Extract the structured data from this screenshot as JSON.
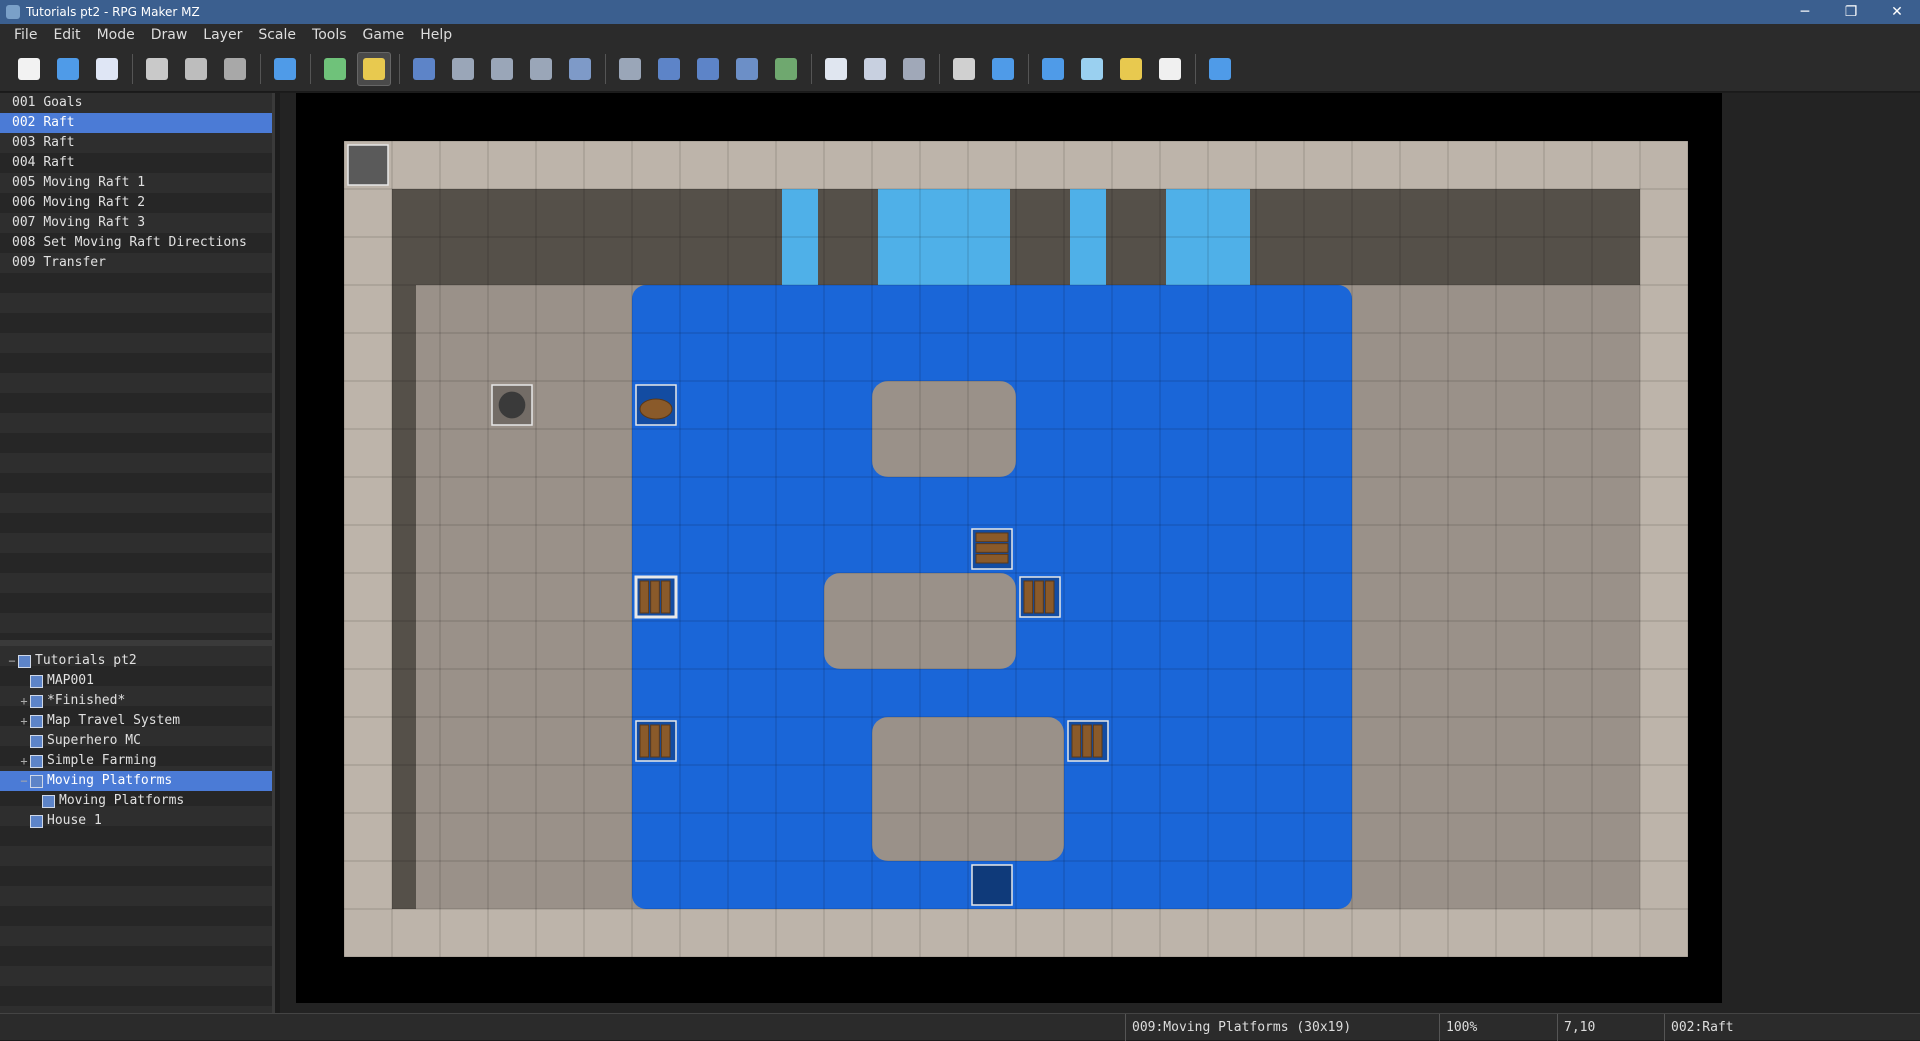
{
  "window": {
    "title": "Tutorials pt2 - RPG Maker MZ",
    "minimize": "─",
    "maximize": "❐",
    "close": "✕"
  },
  "menu": [
    "File",
    "Edit",
    "Mode",
    "Draw",
    "Layer",
    "Scale",
    "Tools",
    "Game",
    "Help"
  ],
  "toolbar": {
    "groups": [
      [
        {
          "name": "new-project-icon",
          "color": "#f2f2f2"
        },
        {
          "name": "open-project-icon",
          "color": "#4f9be8"
        },
        {
          "name": "save-project-icon",
          "color": "#dfe6f5"
        }
      ],
      [
        {
          "name": "cut-icon",
          "color": "#c9c9c9"
        },
        {
          "name": "copy-icon",
          "color": "#bdbdbd"
        },
        {
          "name": "paste-icon",
          "color": "#a8a8a8"
        }
      ],
      [
        {
          "name": "undo-icon",
          "color": "#4f9be8"
        }
      ],
      [
        {
          "name": "map-mode-icon",
          "color": "#6fc27a"
        },
        {
          "name": "event-mode-icon",
          "color": "#e8c94f",
          "active": true
        }
      ],
      [
        {
          "name": "layer-1-icon",
          "color": "#5d84c8"
        },
        {
          "name": "layer-2-icon",
          "color": "#9aa6b8"
        },
        {
          "name": "layer-3-icon",
          "color": "#9aa6b8"
        },
        {
          "name": "layer-4-icon",
          "color": "#9aa6b8"
        },
        {
          "name": "layer-all-icon",
          "color": "#7e9ac8"
        }
      ],
      [
        {
          "name": "pencil-icon",
          "color": "#9aa6b8"
        },
        {
          "name": "rectangle-icon",
          "color": "#5d84c8"
        },
        {
          "name": "ellipse-icon",
          "color": "#5d84c8"
        },
        {
          "name": "flood-fill-icon",
          "color": "#6c8fc7"
        },
        {
          "name": "shadow-pen-icon",
          "color": "#6fa86f"
        }
      ],
      [
        {
          "name": "zoom-in-icon",
          "color": "#e0e6f0"
        },
        {
          "name": "zoom-out-icon",
          "color": "#c8d0e0"
        },
        {
          "name": "actual-size-icon",
          "color": "#a0a8b8"
        }
      ],
      [
        {
          "name": "database-icon",
          "color": "#d0d0d0"
        },
        {
          "name": "plugin-manager-icon",
          "color": "#4f9be8"
        }
      ],
      [
        {
          "name": "sound-test-icon",
          "color": "#4f9be8"
        },
        {
          "name": "event-searcher-icon",
          "color": "#9ad0f0"
        },
        {
          "name": "resource-manager-icon",
          "color": "#e8c94f"
        },
        {
          "name": "character-generator-icon",
          "color": "#f0f0f0"
        }
      ],
      [
        {
          "name": "playtest-icon",
          "color": "#4f9be8"
        }
      ]
    ]
  },
  "events": [
    {
      "id": "001",
      "name": "Goals"
    },
    {
      "id": "002",
      "name": "Raft",
      "selected": true
    },
    {
      "id": "003",
      "name": "Raft"
    },
    {
      "id": "004",
      "name": "Raft"
    },
    {
      "id": "005",
      "name": "Moving Raft 1"
    },
    {
      "id": "006",
      "name": "Moving Raft 2"
    },
    {
      "id": "007",
      "name": "Moving Raft 3"
    },
    {
      "id": "008",
      "name": "Set Moving Raft Directions"
    },
    {
      "id": "009",
      "name": "Transfer"
    }
  ],
  "map_tree": [
    {
      "label": "Tutorials pt2",
      "level": 0,
      "toggle": "−",
      "root": true
    },
    {
      "label": "MAP001",
      "level": 1,
      "toggle": ""
    },
    {
      "label": "*Finished*",
      "level": 1,
      "toggle": "+"
    },
    {
      "label": "Map Travel System",
      "level": 1,
      "toggle": "+"
    },
    {
      "label": "Superhero MC",
      "level": 1,
      "toggle": ""
    },
    {
      "label": "Simple Farming",
      "level": 1,
      "toggle": "+"
    },
    {
      "label": "Moving Platforms",
      "level": 1,
      "toggle": "−",
      "selected": true
    },
    {
      "label": "Moving Platforms",
      "level": 2,
      "toggle": ""
    },
    {
      "label": "House 1",
      "level": 1,
      "toggle": ""
    }
  ],
  "map": {
    "cols": 28,
    "rows": 17,
    "colors": {
      "stone": "#9a9189",
      "stone_light": "#bdb4aa",
      "cliff": "#555049",
      "water": "#1a66d8",
      "waterfall": "#4fb0e8",
      "black": "#000000",
      "event_border": "#e8e8e8",
      "raft": "#8a5a2a",
      "raft_dark": "#5a3818"
    },
    "cliff_top_row": 1,
    "cliff_rows": 2,
    "waterfall_cols": [
      [
        9,
        9
      ],
      [
        11,
        13
      ],
      [
        15,
        15
      ],
      [
        17,
        18
      ]
    ],
    "water_region": {
      "col_start": 6,
      "col_end": 20,
      "row_start": 3,
      "row_end": 15
    },
    "islands": [
      {
        "col": 11,
        "row": 5,
        "w": 3,
        "h": 2
      },
      {
        "col": 10,
        "row": 9,
        "w": 4,
        "h": 2
      },
      {
        "col": 11,
        "row": 12,
        "w": 4,
        "h": 3
      }
    ],
    "events": [
      {
        "name": "map-event-goals",
        "col": 0,
        "row": 0,
        "kind": "tile"
      },
      {
        "name": "map-event-npc",
        "col": 3,
        "row": 5,
        "kind": "npc"
      },
      {
        "name": "map-event-boat",
        "col": 6,
        "row": 5,
        "kind": "boat"
      },
      {
        "name": "map-event-raft-vertical",
        "col": 13,
        "row": 8,
        "kind": "raft-h"
      },
      {
        "name": "map-event-raft-selected",
        "col": 6,
        "row": 9,
        "kind": "raft",
        "selected": true
      },
      {
        "name": "map-event-raft",
        "col": 14,
        "row": 9,
        "kind": "raft"
      },
      {
        "name": "map-event-moving-raft-1",
        "col": 6,
        "row": 12,
        "kind": "raft"
      },
      {
        "name": "map-event-moving-raft-2",
        "col": 15,
        "row": 12,
        "kind": "raft"
      },
      {
        "name": "map-event-transfer",
        "col": 13,
        "row": 15,
        "kind": "transfer"
      }
    ]
  },
  "status": {
    "map": "009:Moving Platforms (30x19)",
    "zoom": "100%",
    "coords": "7,10",
    "event": "002:Raft"
  }
}
